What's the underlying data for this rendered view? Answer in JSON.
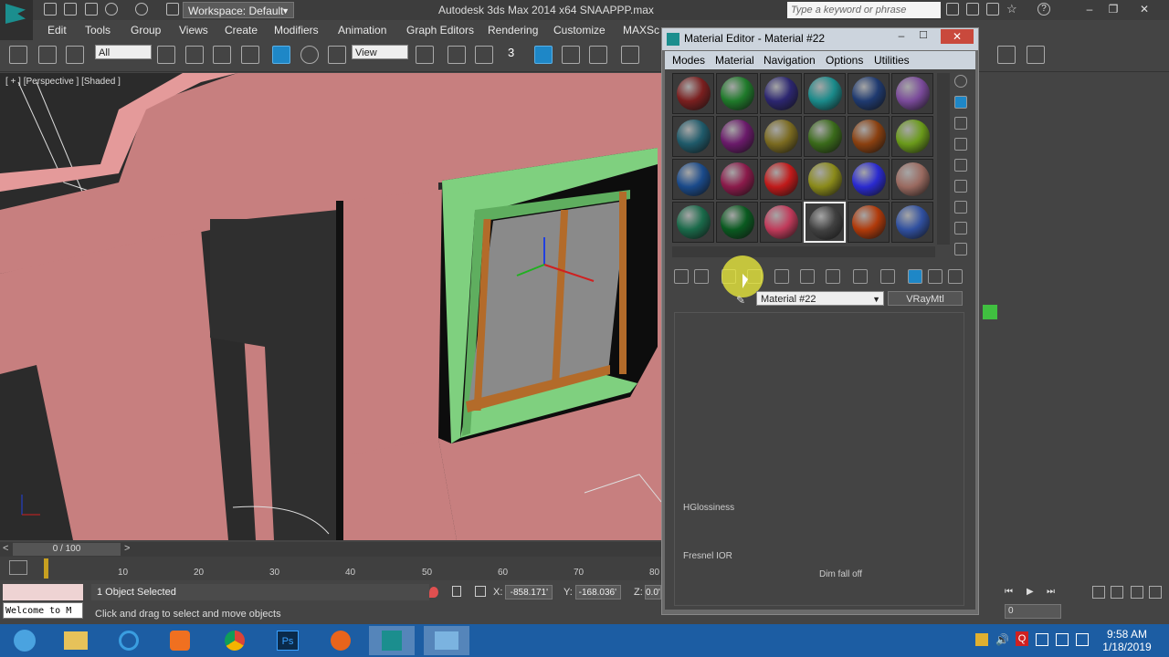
{
  "titlebar": {
    "workspace": "Workspace: Default",
    "app_title": "Autodesk 3ds Max  2014 x64     SNAAPPP.max",
    "search_placeholder": "Type a keyword or phrase"
  },
  "menubar": {
    "items": [
      "Edit",
      "Tools",
      "Group",
      "Views",
      "Create",
      "Modifiers",
      "Animation",
      "Graph Editors",
      "Rendering",
      "Customize",
      "MAXSc"
    ]
  },
  "toolbar": {
    "selection_filter": "All",
    "ref_coord": "View",
    "snap_label": "3"
  },
  "viewport": {
    "label": "[ + ] [Perspective ] [Shaded ]"
  },
  "timeline": {
    "frame": "0 / 100",
    "ticks": [
      "10",
      "20",
      "30",
      "40",
      "50",
      "60",
      "70",
      "80"
    ]
  },
  "status": {
    "welcome": "Welcome to M",
    "selection": "1 Object Selected",
    "prompt": "Click and drag to select and move objects",
    "x_label": "X:",
    "x_value": "-858.171'",
    "y_label": "Y:",
    "y_value": "-168.036'",
    "z_label": "Z:",
    "z_value": "0.0'",
    "frame_value": "0"
  },
  "material_editor": {
    "title": "Material Editor - Material #22",
    "menus": [
      "Modes",
      "Material",
      "Navigation",
      "Options",
      "Utilities"
    ],
    "material_name": "Material #22",
    "material_type": "VRayMtl",
    "params": {
      "hglossiness": "HGlossiness",
      "fresnel_ior": "Fresnel IOR",
      "dim_fall_off": "Dim fall off"
    },
    "slot_colors": [
      "#7a1f1f",
      "#1f7a2a",
      "#2c2670",
      "#1a8a8a",
      "#1f3a70",
      "#7a4a9a",
      "#1f5a6a",
      "#6a1a6a",
      "#7a6a20",
      "#3a6a1a",
      "#8a4010",
      "#6a9a1a",
      "#1a4a8a",
      "#8a1a4a",
      "#c01a1a",
      "#8a8a1a",
      "#2a2ad0",
      "#9a6a60",
      "#1a6a4a",
      "#0a5a20",
      "#c03a5a",
      "#404040",
      "#b03a0a",
      "#3050a0"
    ]
  },
  "taskbar": {
    "time": "9:58 AM",
    "date": "1/18/2019"
  }
}
